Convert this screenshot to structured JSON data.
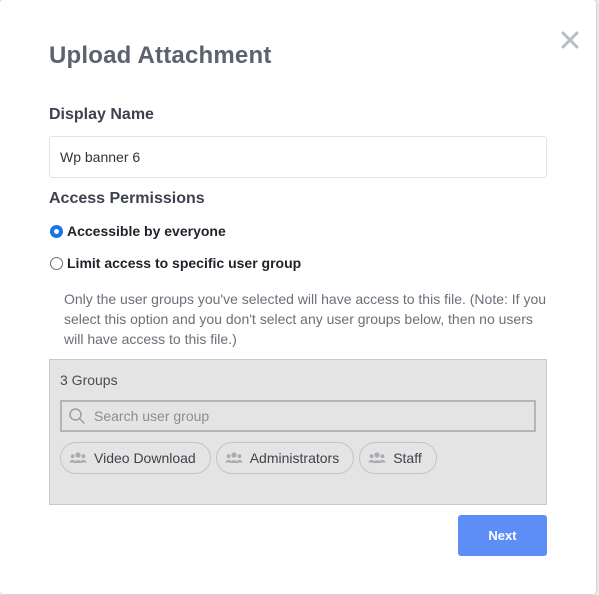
{
  "modal": {
    "title": "Upload Attachment",
    "close_icon": "close-icon"
  },
  "display_name": {
    "label": "Display Name",
    "value": "Wp banner 6"
  },
  "access": {
    "label": "Access Permissions",
    "options": [
      {
        "label": "Accessible by everyone",
        "checked": true
      },
      {
        "label": "Limit access to specific user group",
        "checked": false
      }
    ],
    "note": "Only the user groups you've selected will have access to this file. (Note: If you select this option and you don't select any user groups below, then no users will have access to this file.)"
  },
  "groups": {
    "count_label": "3 Groups",
    "search_placeholder": "Search user group",
    "search_icon": "search-icon",
    "chip_icon": "users-icon",
    "items": [
      {
        "label": "Video Download"
      },
      {
        "label": "Administrators"
      },
      {
        "label": "Staff"
      }
    ]
  },
  "footer": {
    "next_label": "Next"
  },
  "colors": {
    "accent": "#5d8ef8",
    "radio_checked": "#1a73e8",
    "panel_bg": "#e4e4e4"
  }
}
